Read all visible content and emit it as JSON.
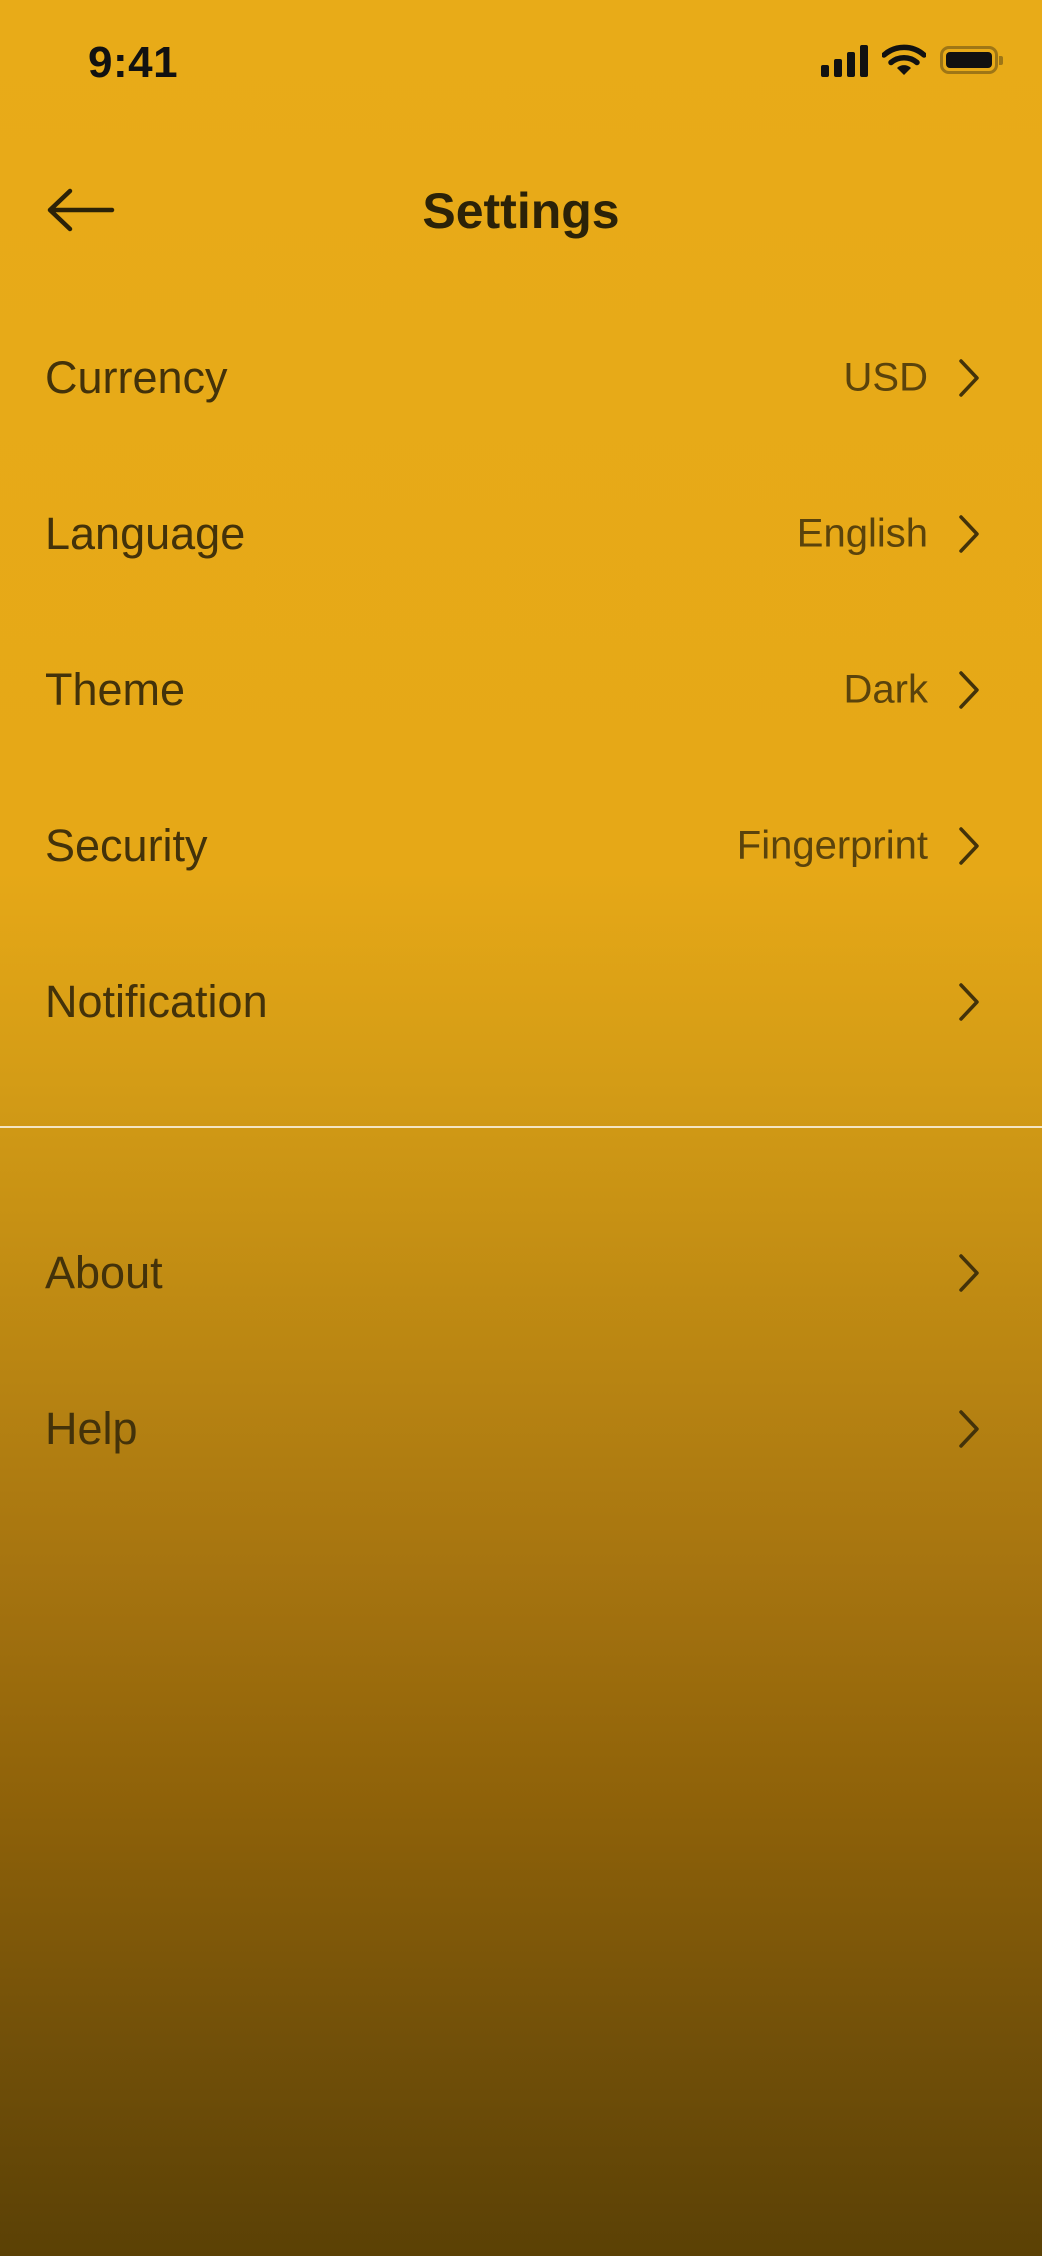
{
  "status_bar": {
    "time": "9:41",
    "icons": [
      "signal-icon",
      "wifi-icon",
      "battery-icon"
    ]
  },
  "header": {
    "title": "Settings",
    "back_icon": "arrow-left-icon"
  },
  "colors": {
    "background_top": "#E8AB18",
    "background_bottom": "#5B4105",
    "text": "#43320a",
    "title": "#2b2208"
  },
  "settings": {
    "primary": [
      {
        "label": "Currency",
        "value": "USD"
      },
      {
        "label": "Language",
        "value": "English"
      },
      {
        "label": "Theme",
        "value": "Dark"
      },
      {
        "label": "Security",
        "value": "Fingerprint"
      },
      {
        "label": "Notification",
        "value": ""
      }
    ],
    "secondary": [
      {
        "label": "About",
        "value": ""
      },
      {
        "label": "Help",
        "value": ""
      }
    ]
  }
}
